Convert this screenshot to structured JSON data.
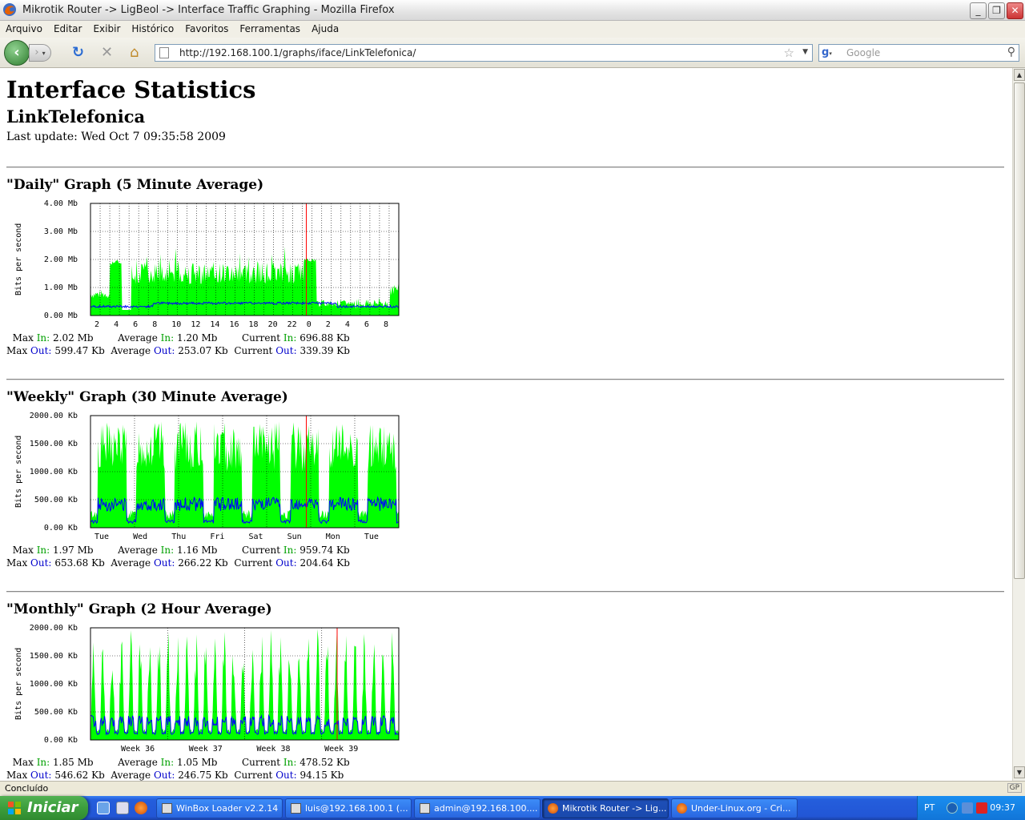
{
  "window": {
    "title": "Mikrotik Router -> LigBeol -> Interface Traffic Graphing - Mozilla Firefox"
  },
  "menu": [
    "Arquivo",
    "Editar",
    "Exibir",
    "Histórico",
    "Favoritos",
    "Ferramentas",
    "Ajuda"
  ],
  "navbar": {
    "url": "http://192.168.100.1/graphs/iface/LinkTelefonica/",
    "search_placeholder": "Google"
  },
  "page": {
    "title": "Interface Statistics",
    "interface": "LinkTelefonica",
    "last_update": "Last update: Wed Oct 7 09:35:58 2009"
  },
  "graphs": [
    {
      "title": "\"Daily\" Graph (5 Minute Average)",
      "y_ticks": [
        "4.00 Mb",
        "3.00 Mb",
        "2.00 Mb",
        "1.00 Mb",
        "0.00 Mb"
      ],
      "x_ticks": [
        "2",
        "4",
        "6",
        "8",
        "10",
        "12",
        "14",
        "16",
        "18",
        "20",
        "22",
        "0",
        "2",
        "4",
        "6",
        "8"
      ],
      "ylabel": "Bits per second",
      "stats": {
        "max_in": "2.02 Mb",
        "avg_in": "1.20 Mb",
        "cur_in": "696.88 Kb",
        "max_out": "599.47 Kb",
        "avg_out": "253.07 Kb",
        "cur_out": "339.39 Kb"
      }
    },
    {
      "title": "\"Weekly\" Graph (30 Minute Average)",
      "y_ticks": [
        "2000.00 Kb",
        "1500.00 Kb",
        "1000.00 Kb",
        "500.00 Kb",
        "0.00 Kb"
      ],
      "x_ticks": [
        "Tue",
        "Wed",
        "Thu",
        "Fri",
        "Sat",
        "Sun",
        "Mon",
        "Tue"
      ],
      "ylabel": "Bits per second",
      "stats": {
        "max_in": "1.97 Mb",
        "avg_in": "1.16 Mb",
        "cur_in": "959.74 Kb",
        "max_out": "653.68 Kb",
        "avg_out": "266.22 Kb",
        "cur_out": "204.64 Kb"
      }
    },
    {
      "title": "\"Monthly\" Graph (2 Hour Average)",
      "y_ticks": [
        "2000.00 Kb",
        "1500.00 Kb",
        "1000.00 Kb",
        "500.00 Kb",
        "0.00 Kb"
      ],
      "x_ticks": [
        "Week 36",
        "Week 37",
        "Week 38",
        "Week 39"
      ],
      "ylabel": "Bits per second",
      "stats": {
        "max_in": "1.85 Mb",
        "avg_in": "1.05 Mb",
        "cur_in": "478.52 Kb",
        "max_out": "546.62 Kb",
        "avg_out": "246.75 Kb",
        "cur_out": "94.15 Kb"
      }
    }
  ],
  "labels": {
    "max": "Max",
    "average": "Average",
    "current": "Current",
    "in": "In:",
    "out": "Out:"
  },
  "status": {
    "text": "Concluído",
    "gp": "GP"
  },
  "taskbar": {
    "start": "Iniciar",
    "tasks": [
      "WinBox Loader v2.2.14",
      "luis@192.168.100.1 (...",
      "admin@192.168.100....",
      "Mikrotik Router -> Lig...",
      "Under-Linux.org - Cri..."
    ],
    "lang": "PT",
    "clock": "09:37"
  },
  "colors": {
    "in_fill": "#00ff00",
    "out_line": "#0000ff",
    "now_marker": "#ff0000"
  }
}
